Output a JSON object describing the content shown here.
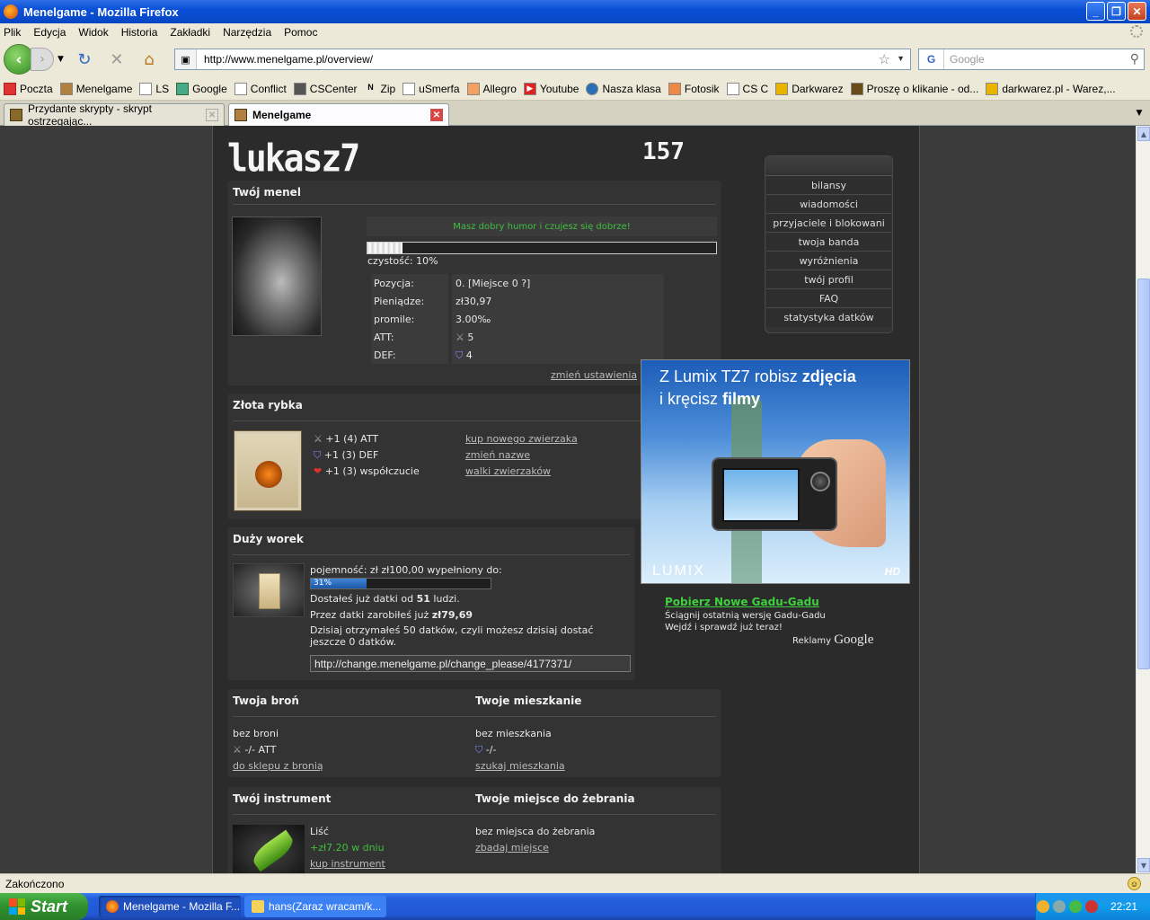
{
  "window": {
    "title": "Menelgame - Mozilla Firefox"
  },
  "menu": [
    "Plik",
    "Edycja",
    "Widok",
    "Historia",
    "Zakładki",
    "Narzędzia",
    "Pomoc"
  ],
  "nav": {
    "url": "http://www.menelgame.pl/overview/",
    "search_placeholder": "Google"
  },
  "bookmarks": [
    "Poczta",
    "Menelgame",
    "LS",
    "Google",
    "Conflict",
    "CSCenter",
    "Zip",
    "uSmerfa",
    "Allegro",
    "Youtube",
    "Nasza klasa",
    "Fotosik",
    "CS C",
    "Darkwarez",
    "Proszę o klikanie - od...",
    "darkwarez.pl - Warez,..."
  ],
  "tabs": [
    {
      "label": "Przydante skrypty - skrypt ostrzegając..."
    },
    {
      "label": "Menelgame"
    }
  ],
  "game": {
    "username": "lukasz7",
    "level": "157",
    "menel": {
      "heading": "Twój menel",
      "mood": "Masz dobry humor i czujesz się dobrze!",
      "cleanliness_label": "czystość: 10%",
      "cleanliness_value": 10,
      "rows": [
        {
          "label": "Pozycja:",
          "value": "0. [Miejsce 0 ?]"
        },
        {
          "label": "Pieniądze:",
          "value": "zł30,97"
        },
        {
          "label": "promile:",
          "value": "3.00‰"
        },
        {
          "label": "ATT:",
          "value": "5"
        },
        {
          "label": "DEF:",
          "value": "4"
        }
      ],
      "settings_link": "zmień ustawienia"
    },
    "fish": {
      "heading": "Złota rybka",
      "stats": [
        "+1 (4) ATT",
        "+1 (3) DEF",
        "+1 (3) współczucie"
      ],
      "links": [
        "kup nowego zwierzaka",
        "zmień nazwe",
        "walki zwierzaków"
      ]
    },
    "bag": {
      "heading": "Duży worek",
      "capacity": "pojemność: zł zł100,00 wypełniony do:",
      "fill_label": "31%",
      "fill_value": 31,
      "line1_a": "Dostałeś już datki od ",
      "line1_b": "51",
      "line1_c": " ludzi.",
      "line2_a": "Przez datki zarobiłeś już ",
      "line2_b": "zł79,69",
      "line3": "Dzisiaj otrzymałeś 50 datków, czyli możesz dzisiaj dostać jeszcze 0 datków.",
      "change_url": "http://change.menelgame.pl/change_please/4177371/"
    },
    "weapon": {
      "heading": "Twoja broń",
      "value": "bez broni",
      "stat": "-/- ATT",
      "link": "do sklepu z bronią"
    },
    "home": {
      "heading": "Twoje mieszkanie",
      "value": "bez mieszkania",
      "stat": "-/-",
      "link": "szukaj mieszkania"
    },
    "instrument": {
      "heading": "Twój instrument",
      "value": "Liść",
      "income": "+zł7.20 w dniu",
      "link": "kup instrument"
    },
    "beg_place": {
      "heading": "Twoje miejsce do żebrania",
      "value": "bez miejsca do żebrania",
      "link": "zbadaj miejsce"
    },
    "side_menu": [
      "bilansy",
      "wiadomości",
      "przyjaciele i blokowani",
      "twoja banda",
      "wyróżnienia",
      "twój profil",
      "FAQ",
      "statystyka datków"
    ]
  },
  "ad": {
    "line1_a": "Z Lumix TZ7 robisz ",
    "line1_b": "zdjęcia",
    "line2_a": "i kręcisz ",
    "line2_b": "filmy",
    "brand": "LUMIX",
    "hd": "HD"
  },
  "gadu": {
    "title": "Pobierz Nowe Gadu-Gadu",
    "line1": "Ściągnij ostatnią wersję Gadu-Gadu",
    "line2": "Wejdź i sprawdź już teraz!",
    "ads_by": "Reklamy",
    "google": "Google"
  },
  "status": {
    "text": "Zakończono"
  },
  "taskbar": {
    "start": "Start",
    "tasks": [
      "Menelgame - Mozilla F...",
      "hans(Zaraz wracam/k..."
    ],
    "clock": "22:21"
  },
  "colors": {
    "accent_green": "#3fbf3f",
    "page_bg": "#2b2b2b",
    "box_bg": "#333333"
  }
}
